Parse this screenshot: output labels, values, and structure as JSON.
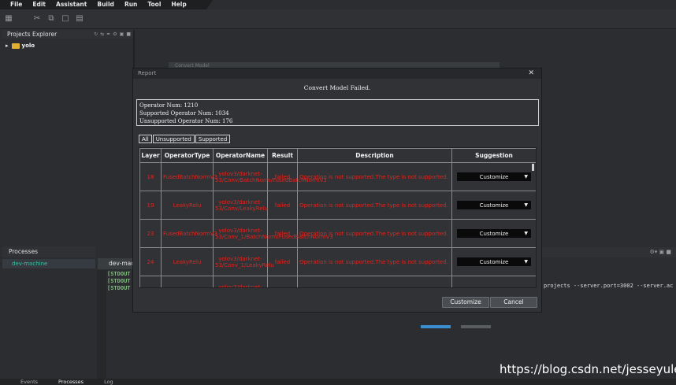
{
  "menubar": {
    "items": [
      "File",
      "Edit",
      "Assistant",
      "Build",
      "Run",
      "Tool",
      "Help"
    ]
  },
  "toolbar": {
    "icons": [
      "open-folder-icon",
      "cut-icon",
      "copy-icon",
      "paste-icon",
      "delete-icon"
    ]
  },
  "projects": {
    "title": "Projects Explorer",
    "tree": [
      {
        "label": "yolo"
      }
    ]
  },
  "processes": {
    "title": "Processes",
    "items": [
      "dev-machine"
    ]
  },
  "console": {
    "tab_label": "dev-mac",
    "lines": [
      "[STDOUT",
      "[STDOUT",
      "[STDOUT"
    ],
    "command_text": "projects --server.port=3002 --server.ac"
  },
  "bottom_tabs": [
    "Events",
    "Processes",
    "Log"
  ],
  "report": {
    "title": "Report",
    "heading": "Convert Model Failed.",
    "summary": [
      "Operator Num: 1210",
      "Supported Operator Num: 1034",
      "Unsupported Operator Num: 176"
    ],
    "filter_tabs": [
      "All",
      "Unsupported",
      "Supported"
    ],
    "columns": [
      "Layer",
      "OperatorType",
      "OperatorName",
      "Result",
      "Description",
      "Suggestion"
    ],
    "rows": [
      {
        "layer": "18",
        "type": "FusedBatchNormV3",
        "name": "yolov3/darknet-53/Conv/BatchNorm/FusedBatchNormV3",
        "result": "failed",
        "description": "Operation is not supported.The type is not supported.",
        "suggestion": "Customize"
      },
      {
        "layer": "19",
        "type": "LeakyRelu",
        "name": "yolov3/darknet-53/Conv/LeakyRelu",
        "result": "failed",
        "description": "Operation is not supported.The type is not supported.",
        "suggestion": "Customize"
      },
      {
        "layer": "23",
        "type": "FusedBatchNormV3",
        "name": "yolov3/darknet-53/Conv_1/BatchNorm/FusedBatchNormV3",
        "result": "failed",
        "description": "Operation is not supported.The type is not supported.",
        "suggestion": "Customize"
      },
      {
        "layer": "24",
        "type": "LeakyRelu",
        "name": "yolov3/darknet-53/Conv_1/LeakyRelu",
        "result": "failed",
        "description": "Operation is not supported.The type is not supported.",
        "suggestion": "Customize"
      },
      {
        "layer": "",
        "type": "FusedBatchNorm",
        "name": "yolov3/darknet-53/Conv_2/Batch",
        "result": "",
        "description": "",
        "suggestion": ""
      }
    ],
    "buttons": {
      "customize": "Customize",
      "cancel": "Cancel"
    }
  },
  "ghost_dialog": {
    "title": "Convert Model"
  },
  "watermark": "https://blog.csdn.net/jesseyule",
  "colors": {
    "error_text": "#e0241e",
    "process_text": "#3cc0a0",
    "console_text": "#7ec07e"
  }
}
